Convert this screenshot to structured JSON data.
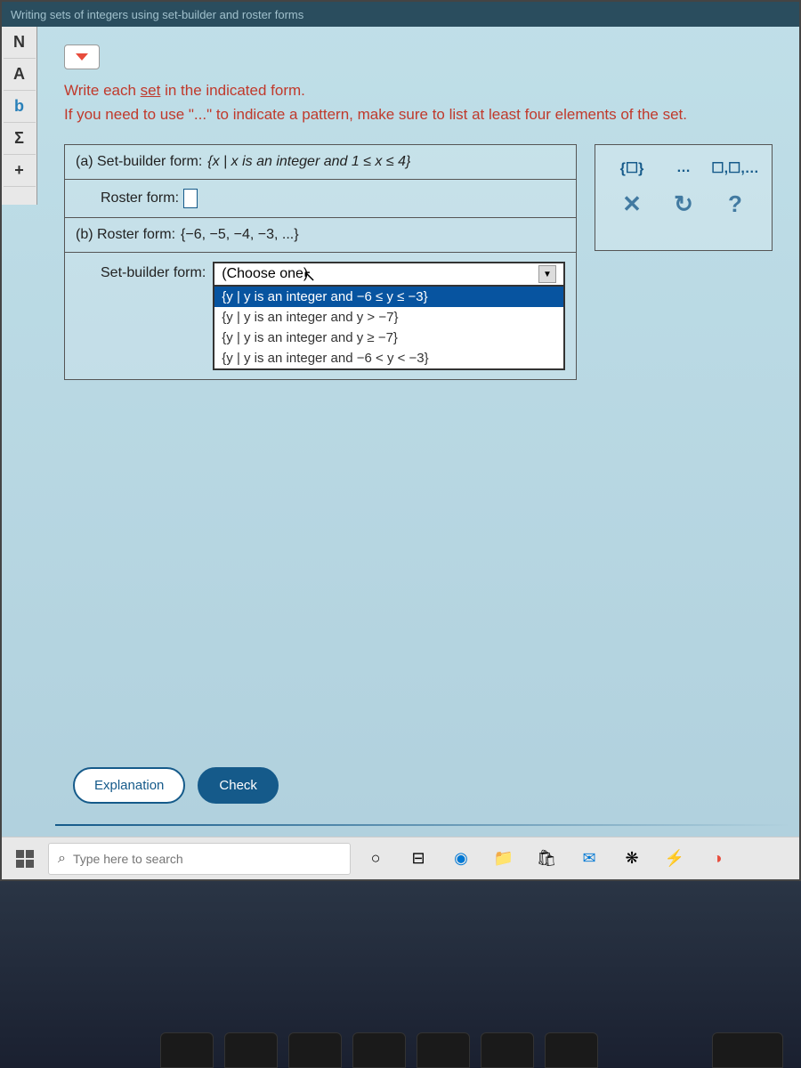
{
  "title_bar": "Writing sets of integers using set-builder and roster forms",
  "left_tabs": [
    "N",
    "A",
    "b",
    "Σ",
    "+"
  ],
  "instructions": {
    "line1_a": "Write each ",
    "line1_b": "set",
    "line1_c": " in the indicated form.",
    "line2": "If you need to use \"...\" to indicate a pattern, make sure to list at least four elements of the set."
  },
  "part_a": {
    "label": "(a)  Set-builder form:",
    "content": "{x | x is an integer and 1 ≤ x ≤ 4}",
    "roster_label": "Roster form:"
  },
  "part_b": {
    "label": "(b)  Roster form:",
    "content": "{−6, −5, −4, −3, ...}",
    "setbuilder_label": "Set-builder form:",
    "dropdown_placeholder": "(Choose one)",
    "dropdown_options": [
      "{y | y is an integer and −6 ≤ y ≤ −3}",
      "{y | y is an integer and y > −7}",
      "{y | y is an integer and y ≥ −7}",
      "{y | y is an integer and −6 < y < −3}"
    ]
  },
  "toolbox": {
    "braces": "{☐}",
    "dots": "…",
    "pattern": "☐,☐,…",
    "close": "✕",
    "reset": "↻",
    "help": "?"
  },
  "buttons": {
    "explanation": "Explanation",
    "check": "Check"
  },
  "taskbar": {
    "search_placeholder": "Type here to search"
  }
}
